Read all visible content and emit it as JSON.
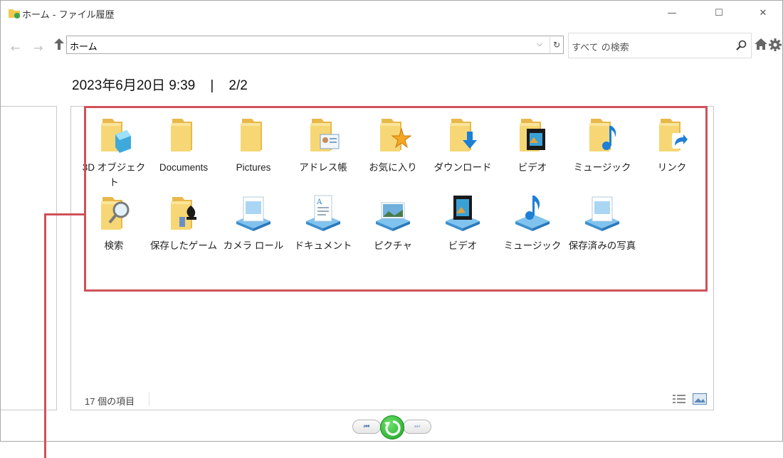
{
  "window": {
    "title": "ホーム - ファイル履歴",
    "min_symbol": "—",
    "max_symbol": "☐",
    "close_symbol": "✕"
  },
  "nav": {
    "back": "←",
    "forward": "→",
    "address": "ホーム",
    "address_chevron": "⌵",
    "refresh": "↻",
    "search_placeholder": "すべて の検索"
  },
  "header": {
    "date": "2023年6月20日 9:39",
    "separator": "|",
    "page": "2/2"
  },
  "items": [
    {
      "label": "3D オブジェクト",
      "icon": "folder-3d-icon"
    },
    {
      "label": "Documents",
      "icon": "folder-icon"
    },
    {
      "label": "Pictures",
      "icon": "folder-icon"
    },
    {
      "label": "アドレス帳",
      "icon": "folder-contacts-icon"
    },
    {
      "label": "お気に入り",
      "icon": "folder-favorites-icon"
    },
    {
      "label": "ダウンロード",
      "icon": "folder-downloads-icon"
    },
    {
      "label": "ビデオ",
      "icon": "folder-videos-icon"
    },
    {
      "label": "ミュージック",
      "icon": "folder-music-icon"
    },
    {
      "label": "リンク",
      "icon": "folder-links-icon"
    },
    {
      "label": "検索",
      "icon": "folder-search-icon"
    },
    {
      "label": "保存したゲーム",
      "icon": "folder-games-icon"
    },
    {
      "label": "カメラ ロール",
      "icon": "library-camera-roll-icon"
    },
    {
      "label": "ドキュメント",
      "icon": "library-documents-icon"
    },
    {
      "label": "ピクチャ",
      "icon": "library-pictures-icon"
    },
    {
      "label": "ビデオ",
      "icon": "library-videos-icon"
    },
    {
      "label": "ミュージック",
      "icon": "library-music-icon"
    },
    {
      "label": "保存済みの写真",
      "icon": "library-saved-pictures-icon"
    }
  ],
  "status": {
    "count": "17 個の項目"
  },
  "controls": {
    "prev": "⏮",
    "next": "⏭"
  },
  "colors": {
    "highlight": "#d0525a",
    "folder": "#f7d775",
    "accent_blue": "#1e7fd6",
    "restore_green": "#1da327"
  }
}
